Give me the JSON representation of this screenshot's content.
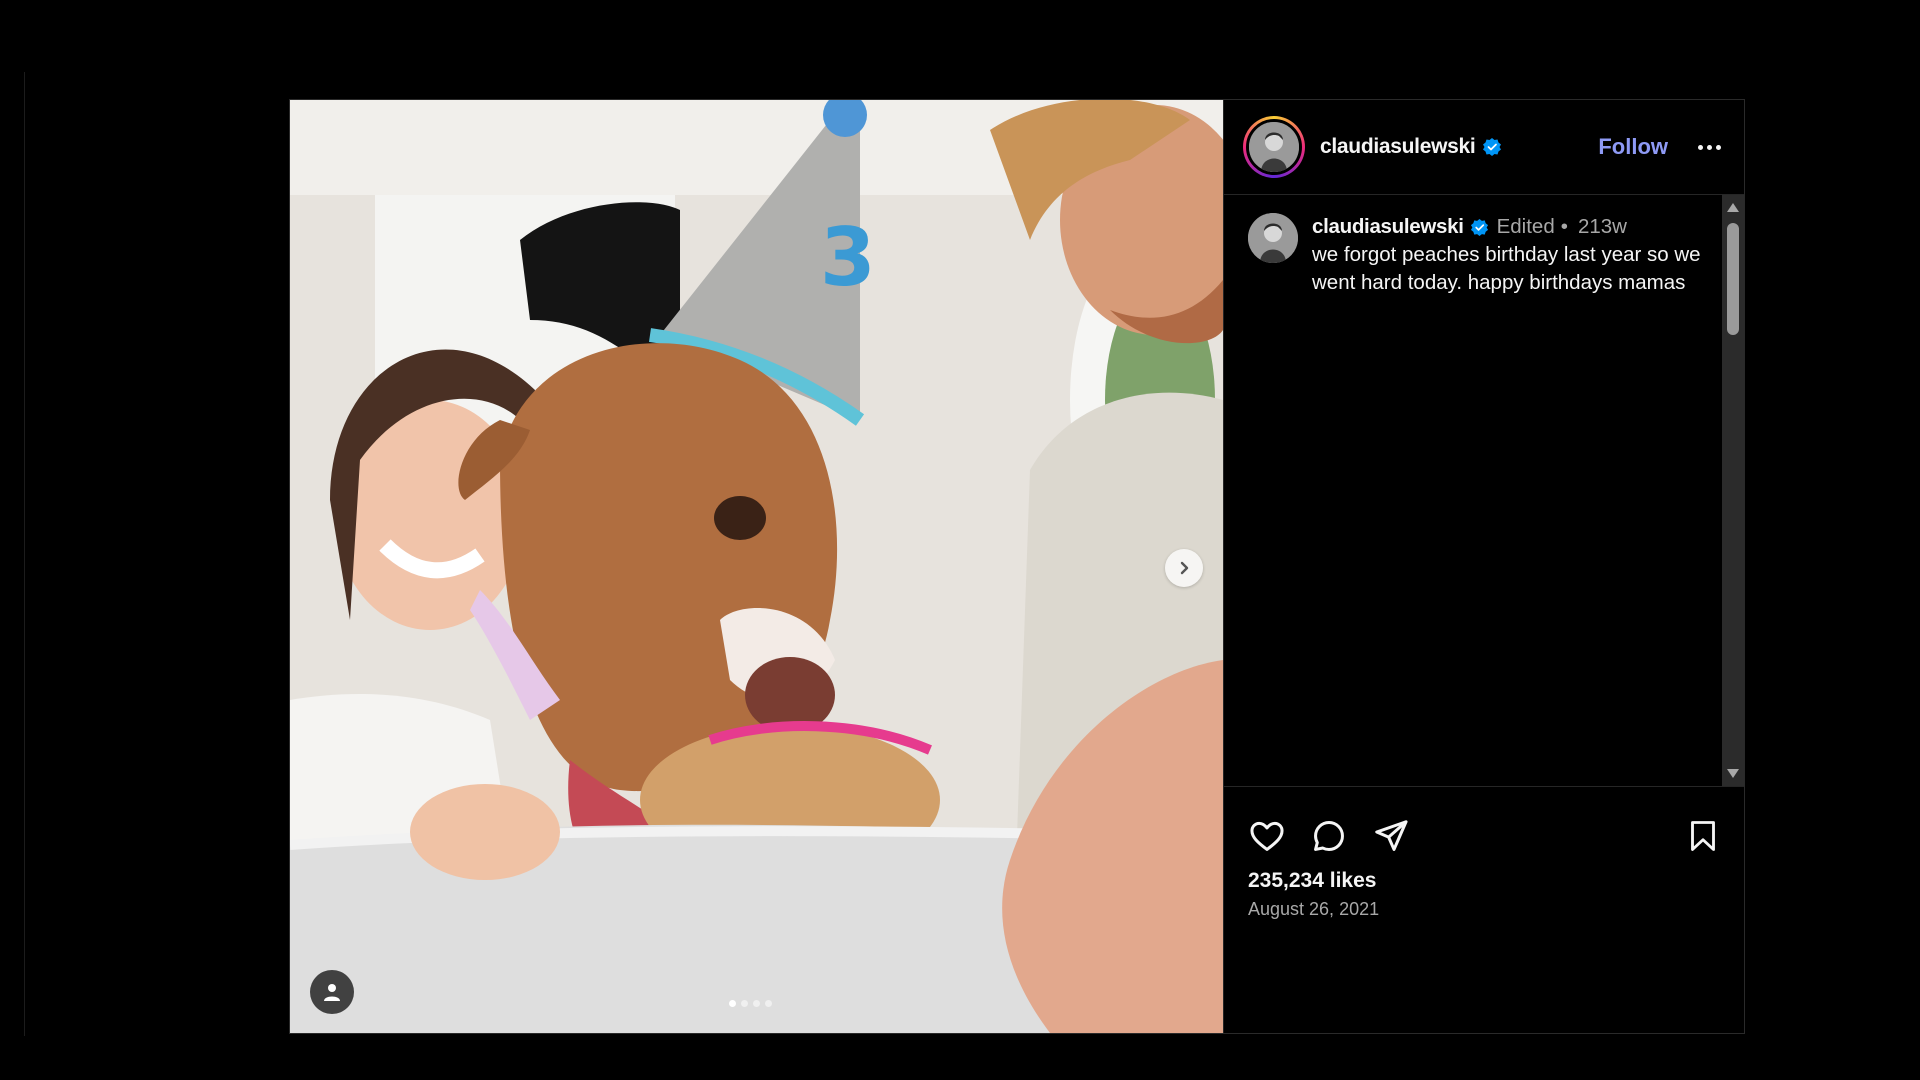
{
  "post": {
    "username": "claudiasulewski",
    "follow_label": "Follow",
    "caption": {
      "username": "claudiasulewski",
      "edited_label": "Edited",
      "separator": "•",
      "time_ago": "213w",
      "text": "we forgot peaches birthday last year so we went hard today. happy birthdays mamas"
    },
    "likes": "235,234 likes",
    "date": "August 26, 2021",
    "carousel": {
      "slide_count": 4,
      "current_slide": 1
    }
  },
  "icons": {
    "verified": "verified-badge-icon",
    "more": "more-options-icon",
    "like": "heart-icon",
    "comment": "comment-icon",
    "share": "share-icon",
    "save": "bookmark-icon",
    "next": "chevron-right-icon",
    "tag": "user-tag-icon"
  },
  "colors": {
    "background": "#000000",
    "follow": "#8e9af5",
    "verified": "#0095f6",
    "muted_text": "#a8a8a8"
  }
}
